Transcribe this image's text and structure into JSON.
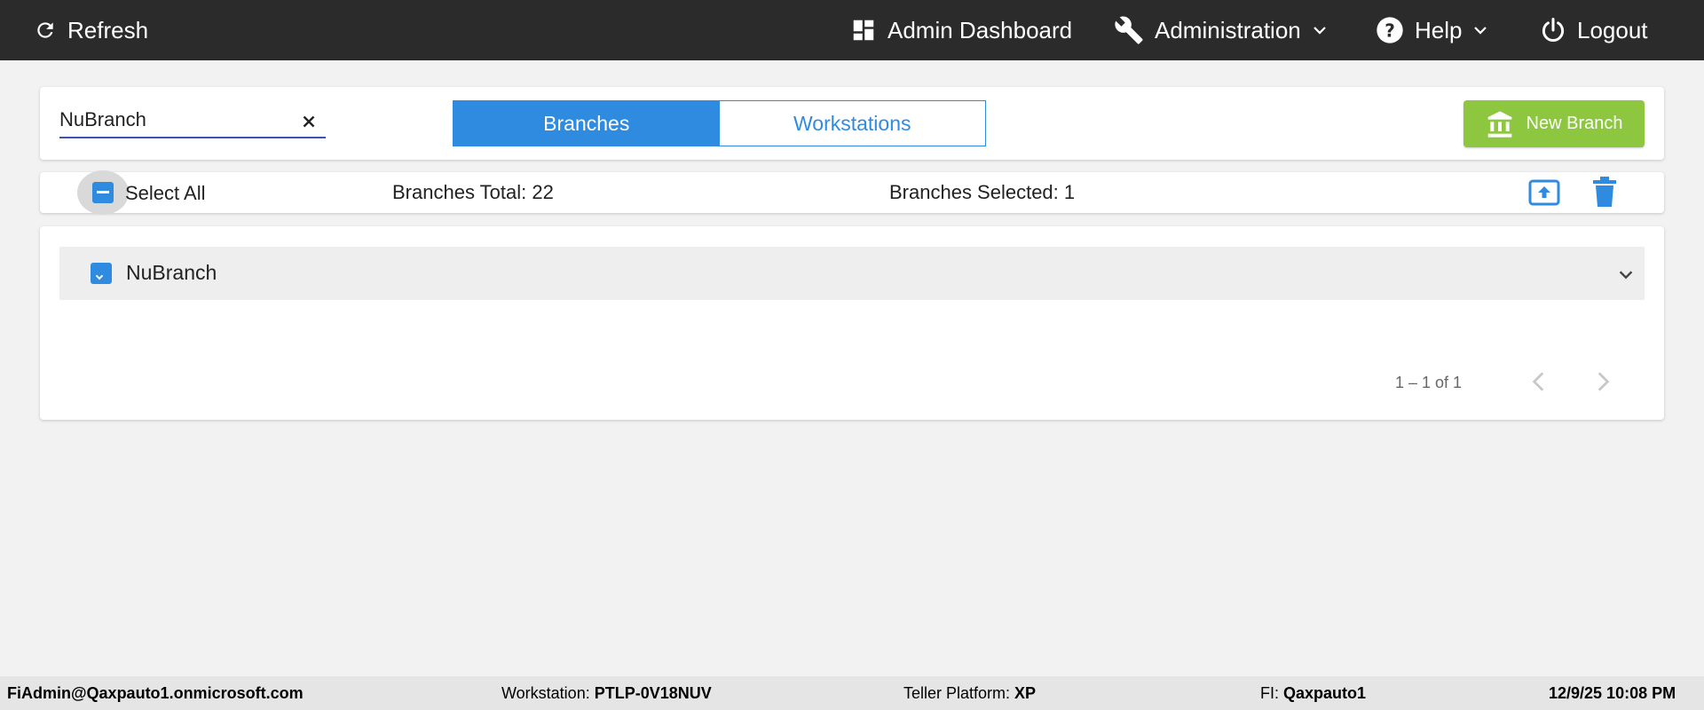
{
  "topbar": {
    "refresh_label": "Refresh",
    "dashboard_label": "Admin Dashboard",
    "administration_label": "Administration",
    "help_label": "Help",
    "logout_label": "Logout"
  },
  "search": {
    "value": "NuBranch",
    "placeholder": ""
  },
  "tabs": [
    {
      "label": "Branches",
      "active": true
    },
    {
      "label": "Workstations",
      "active": false
    }
  ],
  "new_branch_label": "New Branch",
  "selection_bar": {
    "select_all_label": "Select All",
    "total_label": "Branches Total: 22",
    "selected_label": "Branches Selected: 1"
  },
  "list": {
    "items": [
      {
        "label": "NuBranch",
        "checked": true
      }
    ]
  },
  "pagination": {
    "range_label": "1 – 1 of 1"
  },
  "statusbar": {
    "user": "FiAdmin@Qaxpauto1.onmicrosoft.com",
    "workstation_label": "Workstation: ",
    "workstation_value": "PTLP-0V18NUV",
    "teller_platform_label": "Teller Platform: ",
    "teller_platform_value": "XP",
    "fi_label": "FI: ",
    "fi_value": "Qaxpauto1",
    "datetime": "12/9/25 10:08 PM"
  },
  "colors": {
    "topbar": "#2b2b2b",
    "accent_blue": "#2f8be0",
    "new_branch_green": "#8dc63f",
    "background": "#f2f2f2"
  },
  "icons": {
    "refresh": "refresh-icon",
    "dashboard": "dashboard-icon",
    "administration": "wrench-icon",
    "help": "help-circle-icon",
    "logout": "power-icon",
    "clear": "close-icon",
    "new_branch": "bank-icon",
    "export": "upload-icon",
    "delete": "trash-icon",
    "expand": "chevron-down-icon",
    "prev": "chevron-left-icon",
    "next": "chevron-right-icon"
  }
}
